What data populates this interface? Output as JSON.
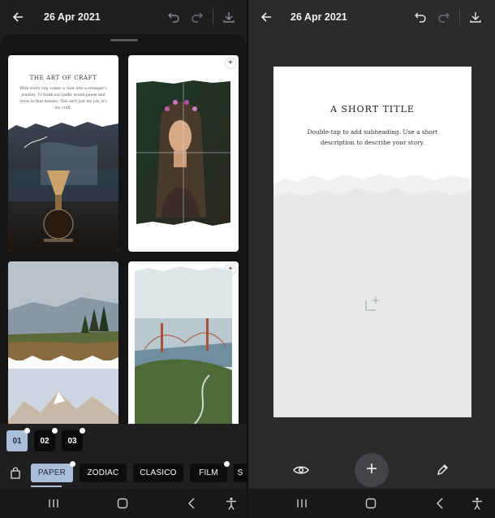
{
  "left": {
    "header": {
      "date": "26 Apr 2021"
    },
    "templates": [
      {
        "title": "THE ART OF CRAFT",
        "body": "With every cup comes a view into a stranger's journey. To think our paths would pause and cross in that minute. This isn't just my job, it's my craft."
      },
      {
        "title": ""
      },
      {
        "title": ""
      },
      {
        "title": ""
      }
    ],
    "pages": [
      "01",
      "02",
      "03"
    ],
    "tabs": [
      "PAPER",
      "ZODIAC",
      "CLASICO",
      "FILM",
      "S"
    ]
  },
  "right": {
    "header": {
      "date": "26 Apr 2021"
    },
    "canvas": {
      "title": "A SHORT TITLE",
      "subtitle": "Double-tap to add subheading. Use a short description to describe your story."
    }
  },
  "colors": {
    "accent": "#a9bfd9",
    "sheet": "#151516",
    "panel": "#2b2b2e"
  },
  "icons": [
    "back-arrow-icon",
    "undo-icon",
    "redo-icon",
    "download-icon",
    "shopping-bag-icon",
    "eye-icon",
    "plus-icon",
    "pencil-icon",
    "recents-icon",
    "home-icon",
    "nav-back-icon",
    "accessibility-icon",
    "image-placeholder-icon"
  ]
}
